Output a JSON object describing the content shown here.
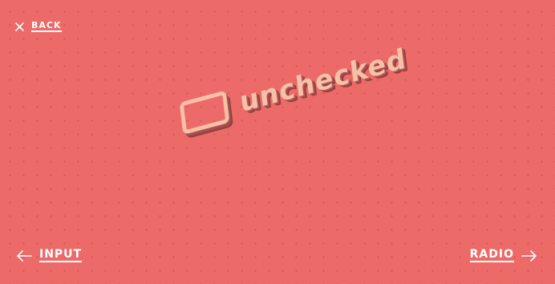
{
  "nav": {
    "back_label": "BACK",
    "prev_label": "INPUT",
    "next_label": "RADIO"
  },
  "demo": {
    "checkbox_state": "unchecked",
    "label": "unchecked"
  },
  "icons": {
    "back": "close-icon",
    "prev": "arrow-left-icon",
    "next": "arrow-right-icon"
  },
  "colors": {
    "background": "#ec6a68",
    "text": "#ffffff",
    "demo_face": "#f6c1a8",
    "demo_shadow": "#9a4543"
  }
}
